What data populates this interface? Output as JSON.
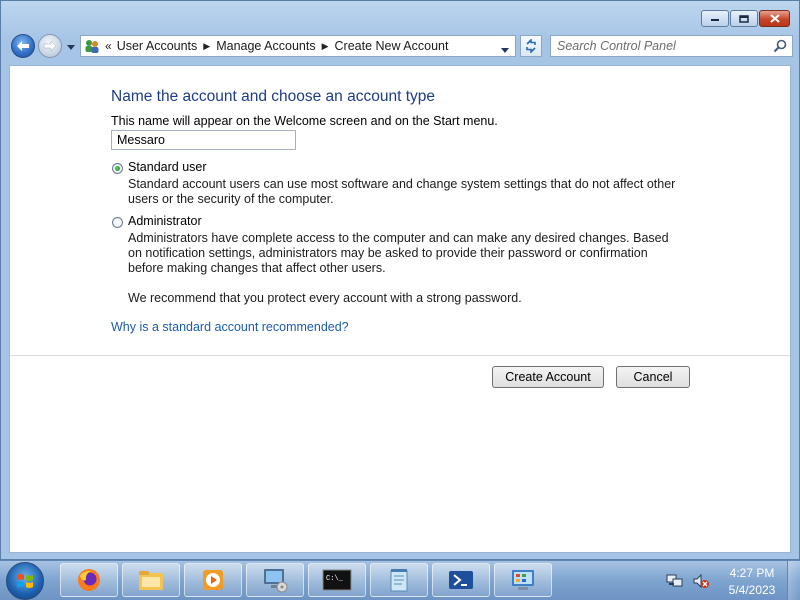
{
  "address": {
    "overflow": "«",
    "crumbs": [
      "User Accounts",
      "Manage Accounts",
      "Create New Account"
    ]
  },
  "search": {
    "placeholder": "Search Control Panel"
  },
  "page": {
    "title": "Name the account and choose an account type",
    "name_description": "This name will appear on the Welcome screen and on the Start menu.",
    "name_value": "Messaro",
    "standard": {
      "label": "Standard user",
      "description": "Standard account users can use most software and change system settings that do not affect other users or the security of the computer.",
      "selected": true
    },
    "administrator": {
      "label": "Administrator",
      "description": "Administrators have complete access to the computer and can make any desired changes. Based on notification settings, administrators may be asked to provide their password or confirmation before making changes that affect other users.",
      "selected": false
    },
    "recommend_note": "We recommend that you protect every account with a strong password.",
    "why_link": "Why is a standard account recommended?",
    "create_button": "Create Account",
    "cancel_button": "Cancel"
  },
  "taskbar": {
    "apps": [
      "firefox-icon",
      "file-explorer-icon",
      "media-player-icon",
      "computer-icon",
      "command-prompt-icon",
      "notepad-icon",
      "powershell-icon",
      "control-panel-icon"
    ],
    "cmd_glyph": "C:\\_",
    "clock": {
      "time": "4:27 PM",
      "date": "5/4/2023"
    }
  },
  "colors": {
    "title_blue": "#1e3c87",
    "link_blue": "#1c5cb0",
    "close_red": "#c7452a"
  }
}
